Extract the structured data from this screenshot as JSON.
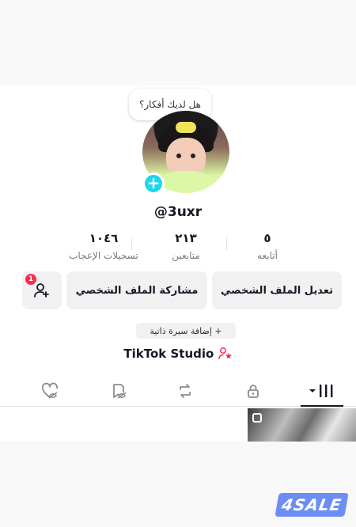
{
  "profile": {
    "idea_bubble": "هل لديك أفكار؟",
    "username": "@3uxr",
    "stats": [
      {
        "value": "٥",
        "label": "أتابعه"
      },
      {
        "value": "٢١٣",
        "label": "متابعين"
      },
      {
        "value": "١٠٤٦",
        "label": "تسجيلات الإعجاب"
      }
    ],
    "buttons": {
      "edit_profile": "تعديل الملف الشخصي",
      "share_profile": "مشاركة الملف الشخصي",
      "add_friends_badge": "1"
    },
    "add_bio": "+ إضافة سيرة ذاتية",
    "studio_label": "TikTok Studio"
  },
  "tabs": [
    {
      "icon": "grid-icon",
      "active": true
    },
    {
      "icon": "lock-icon",
      "active": false
    },
    {
      "icon": "repost-icon",
      "active": false
    },
    {
      "icon": "eye-off-icon",
      "active": false
    },
    {
      "icon": "heart-hidden-icon",
      "active": false
    }
  ],
  "watermark": "4SALE",
  "colors": {
    "accent": "#fe2c55",
    "cyan": "#20d5ec",
    "button_bg": "#f1f1f2",
    "watermark": "#6c8ef4"
  }
}
